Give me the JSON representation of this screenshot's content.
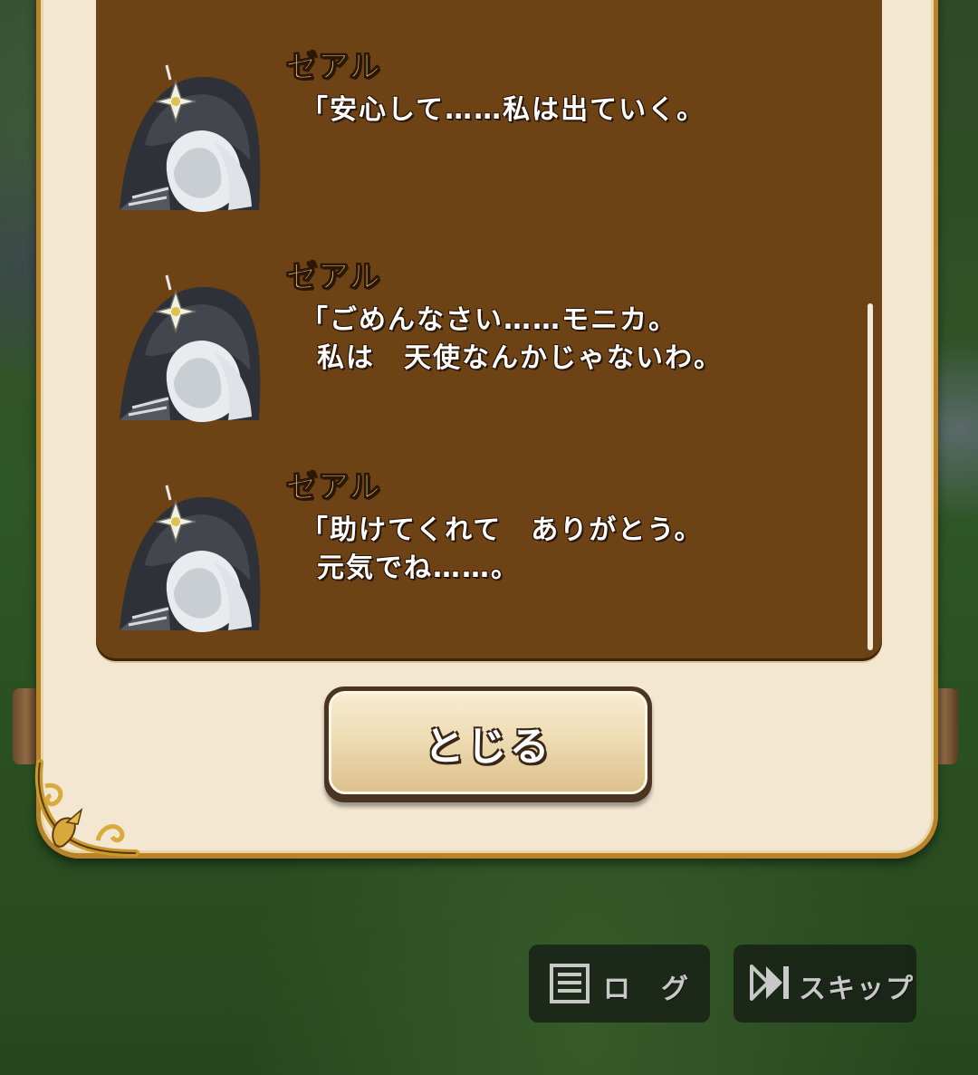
{
  "dialog": {
    "entries": [
      {
        "speaker": "ゼアル",
        "line1": "「安心して……私は出ていく。",
        "line2": ""
      },
      {
        "speaker": "ゼアル",
        "line1": "「ごめんなさい……モニカ。",
        "line2": "私は　天使なんかじゃないわ。"
      },
      {
        "speaker": "ゼアル",
        "line1": "「助けてくれて　ありがとう。",
        "line2": "元気でね……。"
      }
    ],
    "close_label": "とじる"
  },
  "controls": {
    "log_label": "ロ　グ",
    "skip_label": "スキップ",
    "log_icon": "log-list-icon",
    "skip_icon": "fast-forward-icon"
  },
  "colors": {
    "panel_brown": "#6d4316",
    "frame_gold": "#b9832a",
    "speaker_gold": "#f5d16a",
    "parchment": "#f3e7d2"
  }
}
